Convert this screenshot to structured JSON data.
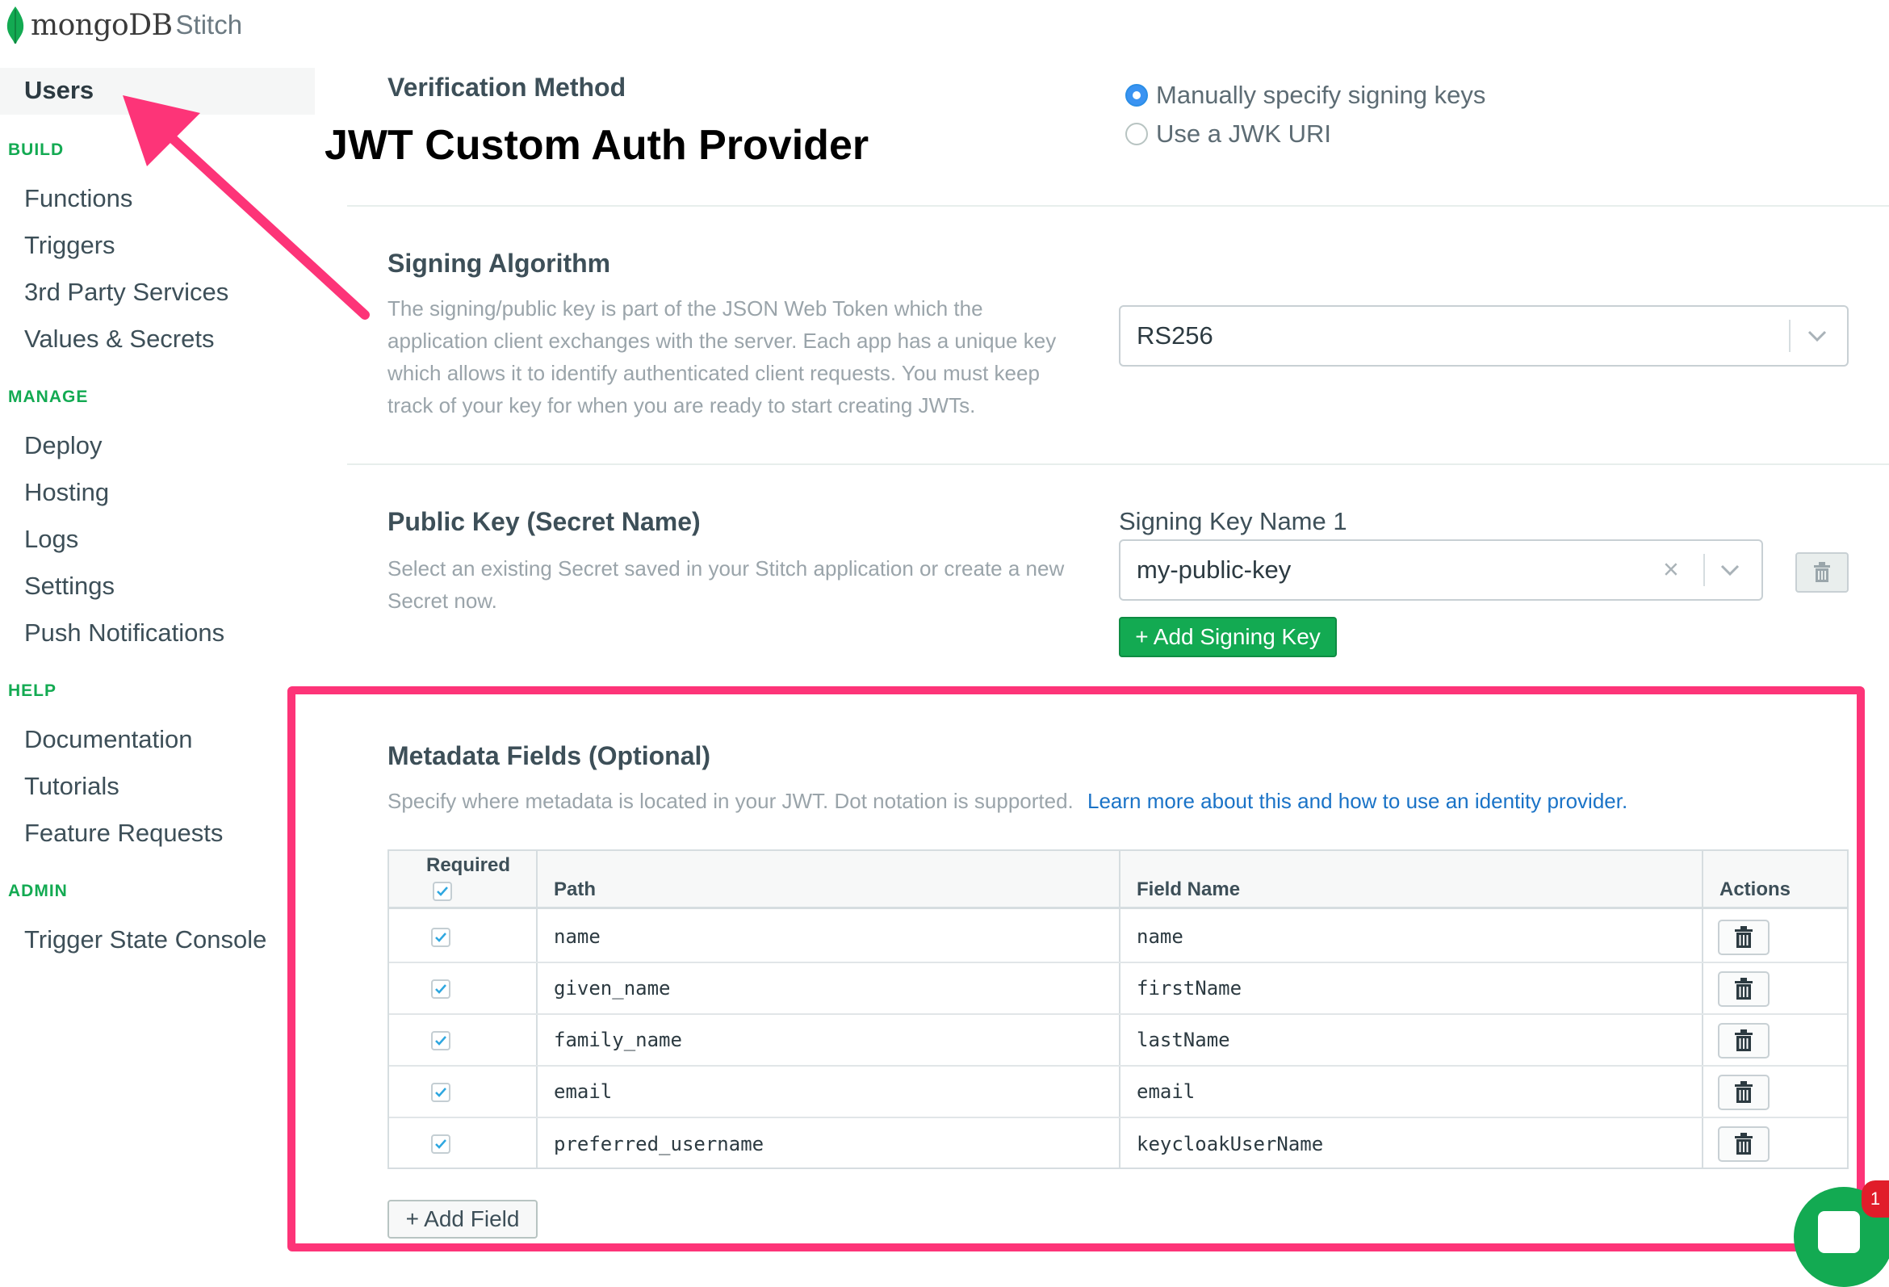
{
  "brand": {
    "name": "mongoDB",
    "product": "Stitch"
  },
  "sidebar": {
    "active_item": "Users",
    "sections": [
      {
        "label": "BUILD",
        "items": [
          "Functions",
          "Triggers",
          "3rd Party Services",
          "Values & Secrets"
        ]
      },
      {
        "label": "MANAGE",
        "items": [
          "Deploy",
          "Hosting",
          "Logs",
          "Settings",
          "Push Notifications"
        ]
      },
      {
        "label": "HELP",
        "items": [
          "Documentation",
          "Tutorials",
          "Feature Requests"
        ]
      },
      {
        "label": "ADMIN",
        "items": [
          "Trigger State Console"
        ]
      }
    ]
  },
  "annotation_title": "JWT Custom Auth Provider",
  "verification": {
    "label": "Verification Method",
    "options": [
      {
        "label": "Manually specify signing keys",
        "checked": true
      },
      {
        "label": "Use a JWK URI",
        "checked": false
      }
    ]
  },
  "signing_algorithm": {
    "label": "Signing Algorithm",
    "description": "The signing/public key is part of the JSON Web Token which the application client exchanges with the server. Each app has a unique key which allows it to identify authenticated client requests. You must keep track of your key for when you are ready to start creating JWTs.",
    "value": "RS256"
  },
  "public_key": {
    "label": "Public Key (Secret Name)",
    "description": "Select an existing Secret saved in your Stitch application or create a new Secret now.",
    "key_label": "Signing Key Name 1",
    "key_value": "my-public-key",
    "add_button": "+ Add Signing Key"
  },
  "metadata": {
    "label": "Metadata Fields (Optional)",
    "description": "Specify where metadata is located in your JWT. Dot notation is supported.",
    "link": "Learn more about this and how to use an identity provider.",
    "columns": {
      "required": "Required",
      "path": "Path",
      "field_name": "Field Name",
      "actions": "Actions"
    },
    "rows": [
      {
        "required": true,
        "path": "name",
        "field_name": "name"
      },
      {
        "required": true,
        "path": "given_name",
        "field_name": "firstName"
      },
      {
        "required": true,
        "path": "family_name",
        "field_name": "lastName"
      },
      {
        "required": true,
        "path": "email",
        "field_name": "email"
      },
      {
        "required": true,
        "path": "preferred_username",
        "field_name": "keycloakUserName"
      }
    ],
    "add_button": "+ Add Field"
  },
  "chat": {
    "badge_count": "1"
  },
  "colors": {
    "accent_green": "#13aa52",
    "highlight_pink": "#fd3478",
    "link_blue": "#1a73c7",
    "radio_blue": "#3a93f2"
  }
}
